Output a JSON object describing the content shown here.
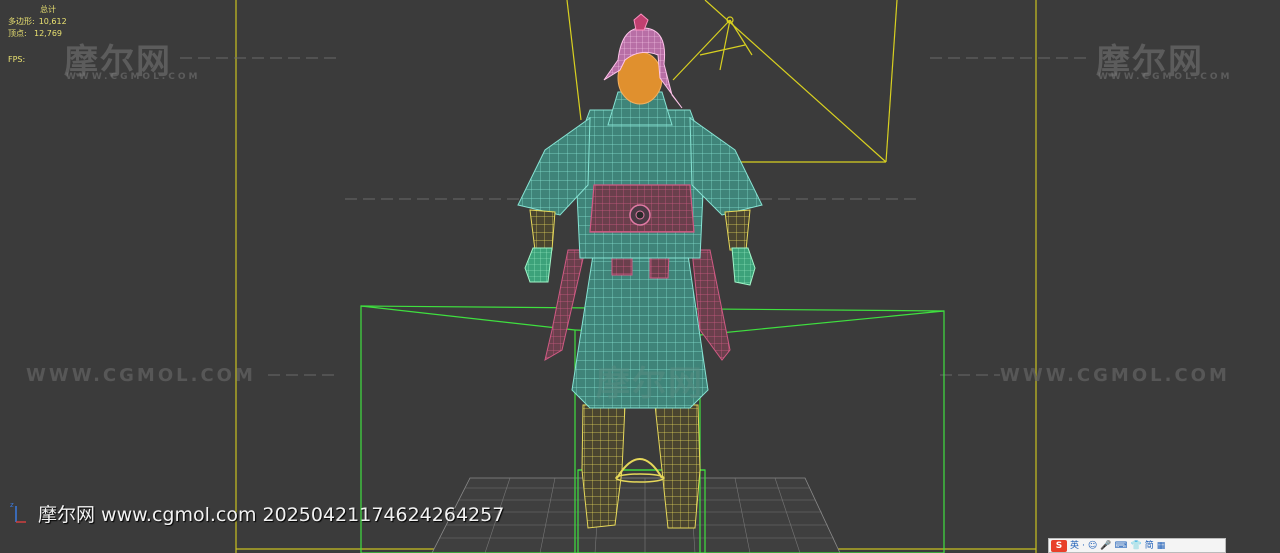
{
  "stats": {
    "header": "总计",
    "polys_label": "多边形:",
    "polys_value": "10,612",
    "verts_label": "顶点:",
    "verts_value": "12,769",
    "fps_label": "FPS:"
  },
  "watermarks": {
    "logo": "摩尔网",
    "sub": "WWW.CGMOL.COM",
    "url": "WWW.CGMOL.COM"
  },
  "footer": {
    "text": "摩尔网 www.cgmol.com 20250421174624264257"
  },
  "axis": {
    "label": "z"
  },
  "ime_bar": {
    "logo": "S",
    "items": [
      "英",
      "·",
      "☺",
      "🎤",
      "⌨",
      "👕",
      "简",
      "▦"
    ]
  },
  "colors": {
    "viewport_bg": "#3b3b3b",
    "stats_text": "#e8e070",
    "frame_yellow": "#d8d020",
    "bbox_green": "#40e040",
    "robe_teal": "#3f8f82",
    "wire_teal": "#7fe6d6",
    "belt_pink": "#c0406a",
    "hair_pink": "#e89ad8",
    "skin_orange": "#e89a40"
  }
}
